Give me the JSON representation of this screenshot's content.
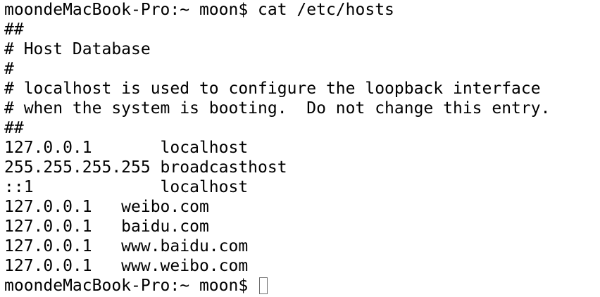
{
  "terminal": {
    "lines": [
      "moondeMacBook-Pro:~ moon$ cat /etc/hosts",
      "##",
      "# Host Database",
      "#",
      "# localhost is used to configure the loopback interface",
      "# when the system is booting.  Do not change this entry.",
      "##",
      "127.0.0.1       localhost",
      "255.255.255.255 broadcasthost",
      "::1             localhost",
      "127.0.0.1   weibo.com",
      "127.0.0.1   baidu.com",
      "127.0.0.1   www.baidu.com",
      "127.0.0.1   www.weibo.com"
    ],
    "prompt": "moondeMacBook-Pro:~ moon$ "
  }
}
